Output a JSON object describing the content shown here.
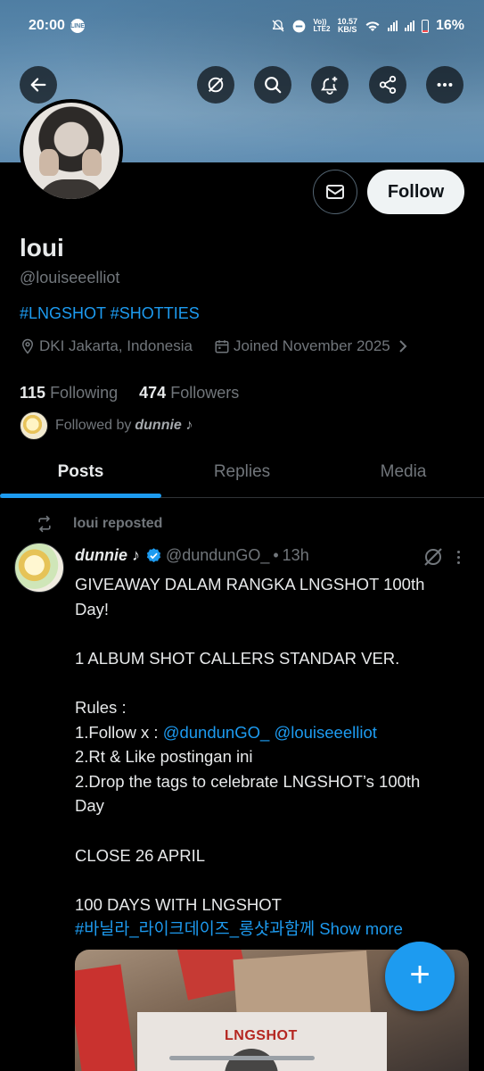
{
  "status_bar": {
    "time": "20:00",
    "line_badge": "LINE",
    "volte_top": "Vo))",
    "volte_bottom": "LTE2",
    "speed_value": "10.57",
    "speed_unit": "KB/S",
    "battery": "16%"
  },
  "top_actions": {
    "back": "back-arrow-icon",
    "grok": "grok-icon",
    "search": "search-icon",
    "notify": "bell-plus-icon",
    "share": "share-icon",
    "more": "more-icon"
  },
  "profile": {
    "name": "loui",
    "handle": "@louiseeelliot",
    "bio": "#LNGSHOT #SHOTTIES",
    "location": "DKI Jakarta, Indonesia",
    "joined": "Joined November 2025",
    "following_count": "115",
    "following_label": "Following",
    "followers_count": "474",
    "followers_label": "Followers",
    "followed_by_prefix": "Followed by",
    "followed_by_name": "dunnie ♪"
  },
  "actions": {
    "follow_label": "Follow"
  },
  "tabs": [
    {
      "label": "Posts",
      "active": true
    },
    {
      "label": "Replies",
      "active": false
    },
    {
      "label": "Media",
      "active": false
    }
  ],
  "post": {
    "repost_text": "loui reposted",
    "author": "dunnie ♪",
    "author_handle": "@dundunGO_",
    "time": "13h",
    "lines": [
      "GIVEAWAY DALAM RANGKA LNGSHOT 100th",
      "Day!",
      "",
      "1 ALBUM SHOT CALLERS STANDAR VER.",
      "",
      "Rules :"
    ],
    "rule1_prefix": "1.Follow x : ",
    "rule1_link1": "@dundunGO_",
    "rule1_link2": "@louiseeelliot",
    "rule2": "2.Rt & Like postingan ini",
    "rule3a": "2.Drop the tags to celebrate LNGSHOT’s 100th",
    "rule3b": "Day",
    "close": "CLOSE 26 APRIL",
    "days": "100 DAYS WITH LNGSHOT",
    "hashtag": "#바닐라_라이크데이즈_롱샷과함께",
    "show_more": "Show more",
    "media_title": "LNGSHOT"
  },
  "fab": {
    "label": "+"
  },
  "colors": {
    "accent": "#1d9bf0",
    "background": "#000000",
    "muted": "#71767b",
    "text": "#e7e9ea"
  }
}
